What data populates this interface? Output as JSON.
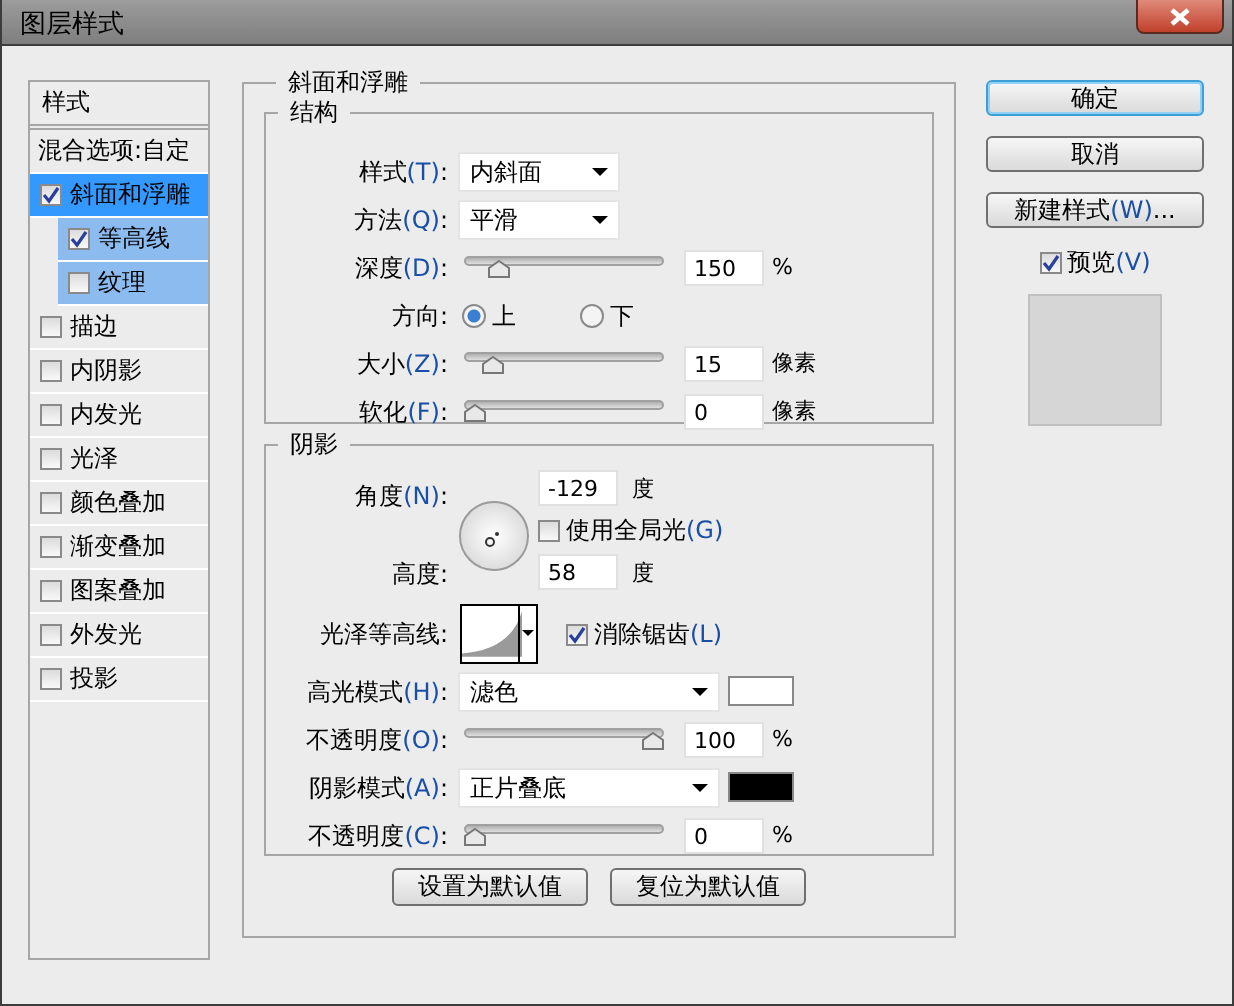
{
  "window": {
    "title": "图层样式"
  },
  "styles_panel": {
    "header": "样式",
    "blending_options": "混合选项:自定",
    "items": [
      {
        "label": "斜面和浮雕",
        "checked": true,
        "selected": true,
        "children": [
          {
            "label": "等高线",
            "checked": true,
            "selected": false
          },
          {
            "label": "纹理",
            "checked": false,
            "selected": false
          }
        ]
      },
      {
        "label": "描边",
        "checked": false,
        "selected": false
      },
      {
        "label": "内阴影",
        "checked": false,
        "selected": false
      },
      {
        "label": "内发光",
        "checked": false,
        "selected": false
      },
      {
        "label": "光泽",
        "checked": false,
        "selected": false
      },
      {
        "label": "颜色叠加",
        "checked": false,
        "selected": false
      },
      {
        "label": "渐变叠加",
        "checked": false,
        "selected": false
      },
      {
        "label": "图案叠加",
        "checked": false,
        "selected": false
      },
      {
        "label": "外发光",
        "checked": false,
        "selected": false
      },
      {
        "label": "投影",
        "checked": false,
        "selected": false
      }
    ]
  },
  "bevel_emboss": {
    "title": "斜面和浮雕",
    "structure": {
      "title": "结构",
      "rows": [
        {
          "kind": "dropdown",
          "label": "样式(T):",
          "value": "内斜面"
        },
        {
          "kind": "dropdown",
          "label": "方法(Q):",
          "value": "平滑"
        },
        {
          "kind": "slider",
          "label": "深度(D):",
          "level": 0.14,
          "value": "150",
          "unit": "%"
        },
        {
          "kind": "radio",
          "label": "方向:",
          "options": [
            {
              "label": "上",
              "selected": true
            },
            {
              "label": "下",
              "selected": false
            }
          ]
        },
        {
          "kind": "slider",
          "label": "大小(Z):",
          "level": 0.1,
          "value": "15",
          "unit": "像素"
        },
        {
          "kind": "slider",
          "label": "软化(F):",
          "level": 0,
          "value": "0",
          "unit": "像素"
        }
      ]
    },
    "shading": {
      "title": "阴影",
      "angle": {
        "label": "角度(N):",
        "value": "-129",
        "unit": "度"
      },
      "global_light": {
        "label": "使用全局光(G)",
        "checked": false
      },
      "altitude": {
        "label": "高度:",
        "value": "58",
        "unit": "度"
      },
      "gloss_contour": {
        "label": "光泽等高线:"
      },
      "anti_aliased": {
        "label": "消除锯齿(L)",
        "checked": true
      },
      "rows": [
        {
          "kind": "mode",
          "label": "高光模式(H):",
          "value": "滤色",
          "color": "#ffffff"
        },
        {
          "kind": "slider",
          "label": "不透明度(O):",
          "level": 1,
          "value": "100",
          "unit": "%"
        },
        {
          "kind": "mode",
          "label": "阴影模式(A):",
          "value": "正片叠底",
          "color": "#000000"
        },
        {
          "kind": "slider",
          "label": "不透明度(C):",
          "level": 0,
          "value": "0",
          "unit": "%"
        }
      ]
    },
    "buttons": [
      "设置为默认值",
      "复位为默认值"
    ]
  },
  "actions": [
    {
      "label": "确定",
      "default": true
    },
    {
      "label": "取消",
      "default": false
    },
    {
      "label": "新建样式(W)...",
      "default": false
    }
  ],
  "preview": {
    "label": "预览(V)",
    "checked": true
  }
}
